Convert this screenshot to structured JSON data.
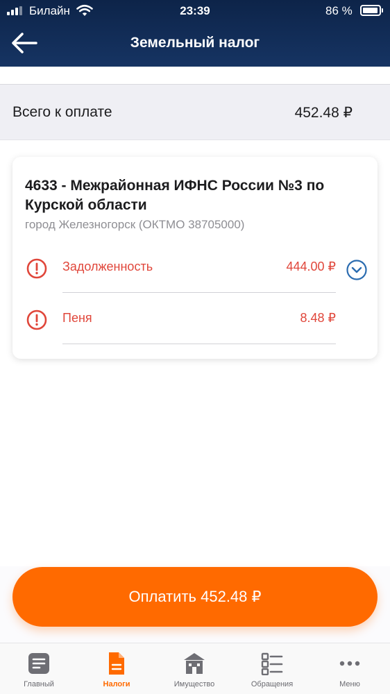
{
  "status_bar": {
    "carrier": "Билайн",
    "time": "23:39",
    "battery": "86 %"
  },
  "header": {
    "title": "Земельный налог"
  },
  "summary": {
    "label": "Всего к оплате",
    "amount": "452.48 ₽"
  },
  "card": {
    "title": "4633 - Межрайонная ИФНС России №3 по Курской области",
    "subtitle": "город Железногорск (ОКТМО 38705000)",
    "items": [
      {
        "label": "Задолженность",
        "amount": "444.00 ₽"
      },
      {
        "label": "Пеня",
        "amount": "8.48 ₽"
      }
    ]
  },
  "pay_button": {
    "label": "Оплатить 452.48 ₽"
  },
  "tabbar": {
    "tabs": [
      {
        "label": "Главный",
        "icon": "document-lines-icon"
      },
      {
        "label": "Налоги",
        "icon": "tax-document-icon"
      },
      {
        "label": "Имущество",
        "icon": "building-icon"
      },
      {
        "label": "Обращения",
        "icon": "checklist-icon"
      },
      {
        "label": "Меню",
        "icon": "more-dots-icon"
      }
    ],
    "active": "Налоги"
  },
  "colors": {
    "header_bg": "#163463",
    "accent": "#ff6a00",
    "alert": "#e0463a",
    "link_blue": "#2b6cb0"
  }
}
